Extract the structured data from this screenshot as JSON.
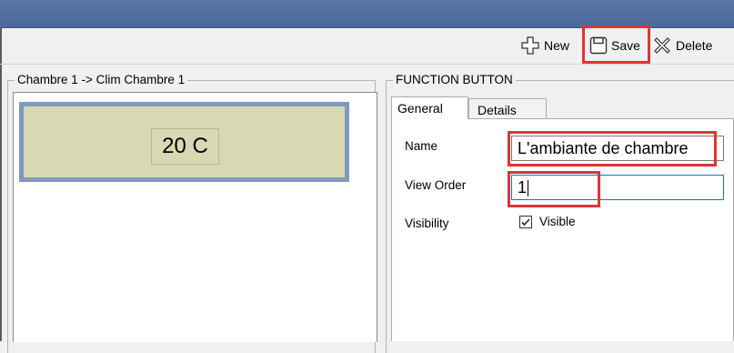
{
  "toolbar": {
    "new_label": "New",
    "save_label": "Save",
    "delete_label": "Delete"
  },
  "left_group": {
    "title": "Chambre 1 -> Clim Chambre 1",
    "device_value": "20 C"
  },
  "right_group": {
    "title": "FUNCTION BUTTON",
    "tabs": [
      {
        "label": "General",
        "selected": true
      },
      {
        "label": "Details",
        "selected": false
      }
    ],
    "fields": {
      "name_label": "Name",
      "name_value": "L'ambiante de chambre",
      "view_order_label": "View Order",
      "view_order_value": "1",
      "visibility_label": "Visibility",
      "visible_label": "Visible",
      "visible_checked": true
    }
  },
  "colors": {
    "titlebar": "#4f6b9c",
    "highlight": "#e03434",
    "tile_background": "#d8d8b2",
    "tile_border": "#8198bf"
  }
}
